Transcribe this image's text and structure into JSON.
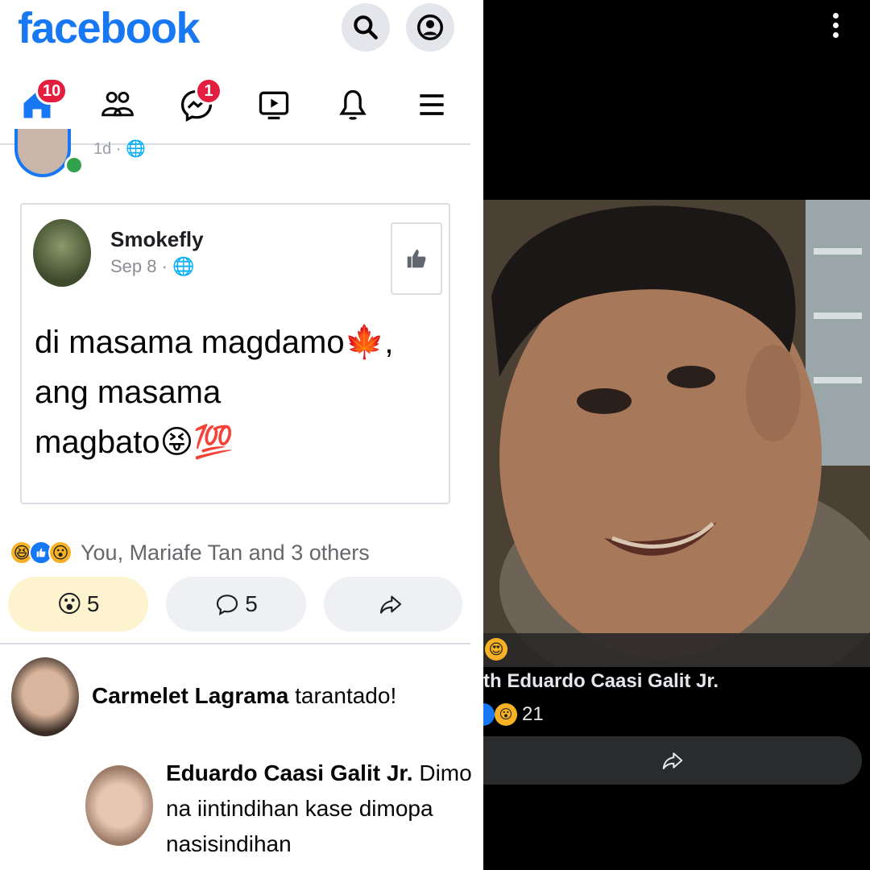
{
  "header": {
    "logo": "facebook",
    "search_icon": "search-icon",
    "profile_icon": "profile-icon"
  },
  "nav": {
    "items": [
      {
        "name": "home",
        "icon": "home-icon",
        "badge": "10"
      },
      {
        "name": "friends",
        "icon": "friends-icon",
        "badge": ""
      },
      {
        "name": "messenger",
        "icon": "messenger-icon",
        "badge": "1"
      },
      {
        "name": "watch",
        "icon": "video-icon",
        "badge": ""
      },
      {
        "name": "notifications",
        "icon": "bell-icon",
        "badge": ""
      },
      {
        "name": "menu",
        "icon": "menu-icon",
        "badge": ""
      }
    ],
    "active_color": "#1877f2",
    "badge_color": "#e41e3f"
  },
  "previous_post": {
    "meta": "1d · "
  },
  "shared_post": {
    "author": "Smokefly",
    "date": "Sep 8 · ",
    "text_line1": "di masama magdamo🍁,",
    "text_line2": "ang masama",
    "text_line3": "magbato😝💯"
  },
  "reactions": {
    "icons": [
      "haha",
      "like",
      "wow"
    ],
    "summary": "You, Mariafe Tan and 3 others"
  },
  "actions": {
    "react_count": "5",
    "comment_count": "5"
  },
  "comments": [
    {
      "author": "Carmelet Lagrama",
      "text": " tarantado!"
    },
    {
      "author": "Eduardo Caasi Galit Jr.",
      "text_line1": " Dimo",
      "text_line2": "na iintindihan kase dimopa",
      "text_line3": "nasisindihan"
    }
  ],
  "right_panel": {
    "tagged": "th Eduardo Caasi Galit Jr.",
    "react_count": "21",
    "background": "#000000"
  }
}
